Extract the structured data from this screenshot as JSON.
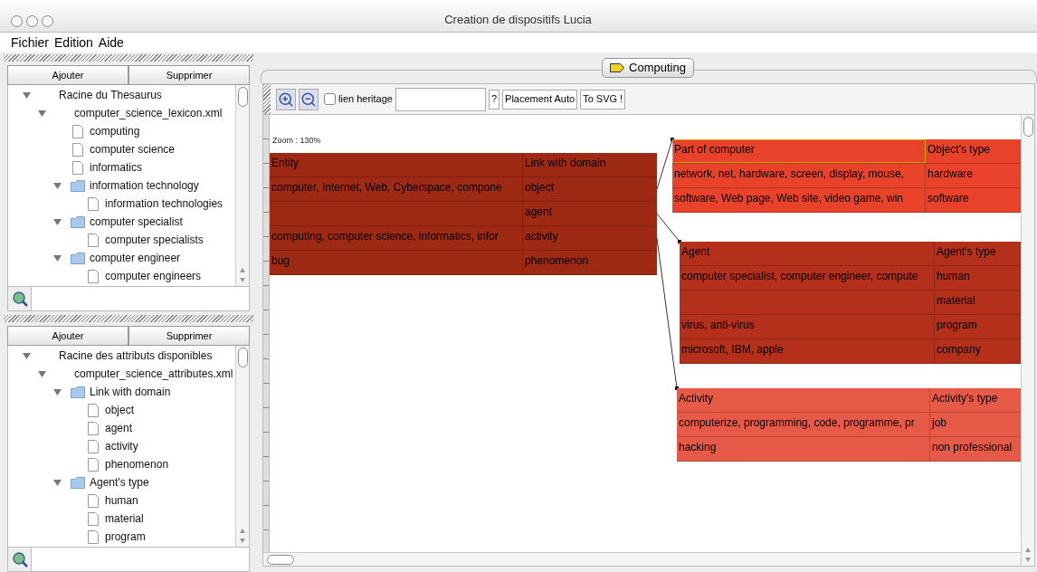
{
  "window": {
    "title": "Creation de dispositifs Lucia"
  },
  "menu": [
    "Fichier",
    "Edition",
    "Aide"
  ],
  "panels": [
    {
      "buttons": [
        "Ajouter",
        "Supprimer"
      ],
      "tree": [
        {
          "label": "Racine du Thesaurus",
          "expanded": true,
          "children": [
            {
              "label": "computer_science_lexicon.xml",
              "expanded": true,
              "children": [
                {
                  "label": "computing",
                  "kind": "file"
                },
                {
                  "label": "computer science",
                  "kind": "file"
                },
                {
                  "label": "informatics",
                  "kind": "file"
                },
                {
                  "label": "information technology",
                  "kind": "folder",
                  "expanded": true,
                  "children": [
                    {
                      "label": "information technologies",
                      "kind": "file"
                    }
                  ]
                },
                {
                  "label": "computer specialist",
                  "kind": "folder",
                  "expanded": true,
                  "children": [
                    {
                      "label": "computer specialists",
                      "kind": "file"
                    }
                  ]
                },
                {
                  "label": "computer engineer",
                  "kind": "folder",
                  "expanded": true,
                  "children": [
                    {
                      "label": "computer engineers",
                      "kind": "file"
                    }
                  ]
                }
              ]
            }
          ]
        }
      ]
    },
    {
      "buttons": [
        "Ajouter",
        "Supprimer"
      ],
      "tree": [
        {
          "label": "Racine des attributs disponibles",
          "expanded": true,
          "children": [
            {
              "label": "computer_science_attributes.xml",
              "expanded": true,
              "children": [
                {
                  "label": "Link with domain",
                  "kind": "folder",
                  "expanded": true,
                  "children": [
                    {
                      "label": "object",
                      "kind": "file"
                    },
                    {
                      "label": "agent",
                      "kind": "file"
                    },
                    {
                      "label": "activity",
                      "kind": "file"
                    },
                    {
                      "label": "phenomenon",
                      "kind": "file"
                    }
                  ]
                },
                {
                  "label": "Agent's type",
                  "kind": "folder",
                  "expanded": true,
                  "children": [
                    {
                      "label": "human",
                      "kind": "file"
                    },
                    {
                      "label": "material",
                      "kind": "file"
                    },
                    {
                      "label": "program",
                      "kind": "file"
                    }
                  ]
                }
              ]
            }
          ]
        }
      ]
    }
  ],
  "tab": {
    "label": "Computing"
  },
  "toolbar": {
    "checkbox": {
      "label": "lien heritage",
      "checked": false
    },
    "buttons": [
      "?",
      "Placement Auto",
      "To SVG !"
    ]
  },
  "zoom_label": "Zoom : 130%",
  "tables": [
    {
      "color": "#9e2a14",
      "selected": false,
      "header": [
        "Entity",
        "Link with domain"
      ],
      "rows": [
        [
          "computer, Internet, Web, Cyberspace, compone",
          "object"
        ],
        [
          "",
          "agent"
        ],
        [
          "computing, computer science, informatics, infor",
          "activity"
        ],
        [
          "bug",
          "phenomenon"
        ]
      ]
    },
    {
      "color": "#e8432a",
      "selected": true,
      "header": [
        "Part of computer",
        "Object's type"
      ],
      "rows": [
        [
          "network, net, hardware, screen, display, mouse,",
          "hardware"
        ],
        [
          "software, Web page, Web site, video game, win",
          "software"
        ]
      ]
    },
    {
      "color": "#b5301a",
      "selected": false,
      "header": [
        "Agent",
        "Agent's type"
      ],
      "rows": [
        [
          "computer specialist, computer engineer, compute",
          "human"
        ],
        [
          "",
          "material"
        ],
        [
          "virus, anti-virus",
          "program"
        ],
        [
          "microsoft, IBM, apple",
          "company"
        ]
      ]
    },
    {
      "color": "#e85a48",
      "selected": false,
      "header": [
        "Activity",
        "Activity's type"
      ],
      "rows": [
        [
          "computerize, programming, code, programme, pr",
          "job"
        ],
        [
          "hacking",
          "non professional"
        ]
      ]
    }
  ]
}
